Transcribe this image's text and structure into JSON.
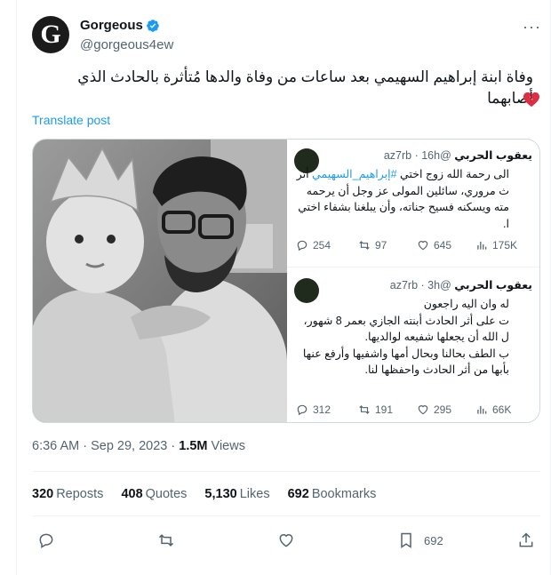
{
  "author": {
    "name": "Gorgeous",
    "handle": "@gorgeous4ew",
    "avatar_letter": "G"
  },
  "more_label": "···",
  "tweet": {
    "text": "وفاة ابنة إبراهيم السهيمي بعد ساعات من وفاة والدها مُتأثرة بالحادث الذي أصابهما",
    "emoji": "broken-heart-icon",
    "translate_label": "Translate post"
  },
  "embedded": [
    {
      "name": "يعقوب الحربي",
      "handle": "@az7rb",
      "time": "· 16h",
      "lines": [
        {
          "pre": "الى رحمة الله زوج اختي ",
          "tag": "#إبراهيم_السهيمي",
          "post": " أثر"
        },
        {
          "pre": "ث مروري، سائلين المولى عز وجل أن يرحمه",
          "tag": "",
          "post": ""
        },
        {
          "pre": "مته ويسكنه فسيح جناته، وأن يبلغنا بشفاء اختي",
          "tag": "",
          "post": ""
        },
        {
          "pre": "ا.",
          "tag": "",
          "post": ""
        }
      ],
      "replies": "254",
      "reposts": "97",
      "likes": "645",
      "views": "175K"
    },
    {
      "name": "يعقوب الحربي",
      "handle": "@az7rb",
      "time": "· 3h",
      "lines": [
        {
          "pre": "له وان اليه راجعون",
          "tag": "",
          "post": ""
        },
        {
          "pre": "ت على أثر الحادث أبنته الجازي بعمر 8 شهور،",
          "tag": "",
          "post": ""
        },
        {
          "pre": "ل الله أن يجعلها شفيعه لوالديها.",
          "tag": "",
          "post": ""
        },
        {
          "pre": " ",
          "tag": "",
          "post": ""
        },
        {
          "pre": "ب الطف بحالنا وبحال أمها واشفيها وأرفع عنها",
          "tag": "",
          "post": ""
        },
        {
          "pre": "بأبها من أثر الحادث واحفظها لنا.",
          "tag": "",
          "post": ""
        }
      ],
      "replies": "312",
      "reposts": "191",
      "likes": "295",
      "views": "66K"
    }
  ],
  "meta": {
    "time": "6:36 AM · Sep 29, 2023 · ",
    "views_count": "1.5M",
    "views_label": " Views"
  },
  "counts": {
    "reposts": "320",
    "reposts_label": "Reposts",
    "quotes": "408",
    "quotes_label": "Quotes",
    "likes": "5,130",
    "likes_label": "Likes",
    "bookmarks": "692",
    "bookmarks_label": "Bookmarks"
  },
  "actions": {
    "bookmark_count": "692"
  },
  "colors": {
    "link": "#1d9bf0",
    "muted": "#536471",
    "text": "#0f1419"
  }
}
